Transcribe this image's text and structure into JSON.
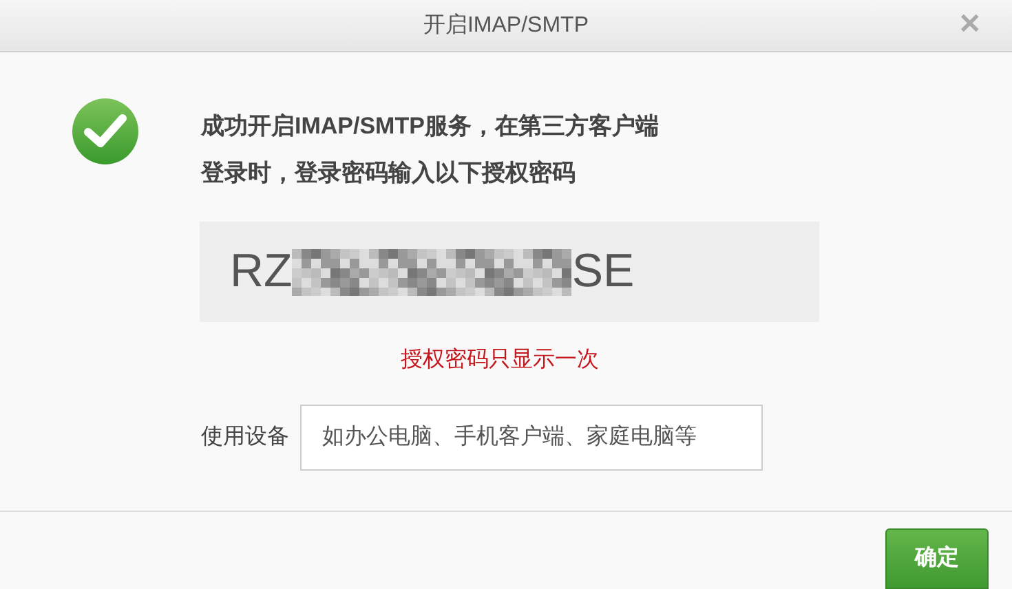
{
  "window": {
    "title": "开启IMAP/SMTP",
    "close": "✕"
  },
  "message": {
    "lines": [
      "成功开启IMAP/SMTP服务，在第三方客户端",
      "登录时，登录密码输入以下授权密码"
    ]
  },
  "code": {
    "start": "RZ",
    "end": "SE"
  },
  "note": "授权密码只显示一次",
  "device": {
    "label": "使用设备",
    "placeholder": "如办公电脑、手机客户端、家庭电脑等"
  },
  "buttons": [
    "确定"
  ]
}
